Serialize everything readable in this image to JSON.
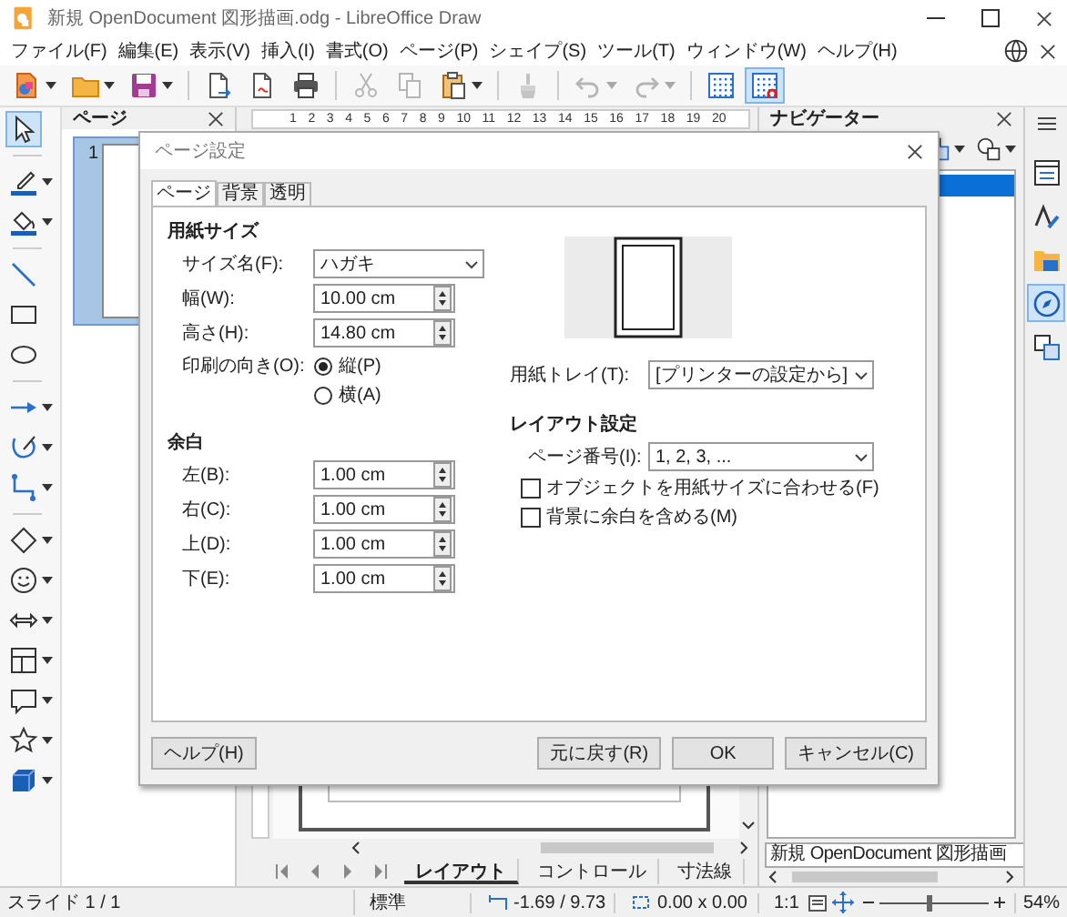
{
  "window": {
    "title": "新規 OpenDocument 図形描画.odg - LibreOffice Draw"
  },
  "menu": [
    "ファイル(F)",
    "編集(E)",
    "表示(V)",
    "挿入(I)",
    "書式(O)",
    "ページ(P)",
    "シェイプ(S)",
    "ツール(T)",
    "ウィンドウ(W)",
    "ヘルプ(H)"
  ],
  "toolbar": [
    [
      {
        "kind": "new",
        "dropdown": true,
        "disabled": false,
        "selected": false
      },
      {
        "kind": "open",
        "dropdown": true,
        "disabled": false,
        "selected": false
      },
      {
        "kind": "save",
        "dropdown": true,
        "disabled": false,
        "selected": false
      }
    ],
    [
      {
        "kind": "export",
        "dropdown": false,
        "disabled": false,
        "selected": false
      },
      {
        "kind": "pdf",
        "dropdown": false,
        "disabled": false,
        "selected": false
      },
      {
        "kind": "print",
        "dropdown": false,
        "disabled": false,
        "selected": false
      }
    ],
    [
      {
        "kind": "cut",
        "dropdown": false,
        "disabled": true,
        "selected": false
      },
      {
        "kind": "copy",
        "dropdown": false,
        "disabled": true,
        "selected": false
      },
      {
        "kind": "paste",
        "dropdown": true,
        "disabled": false,
        "selected": false
      }
    ],
    [
      {
        "kind": "clone",
        "dropdown": false,
        "disabled": true,
        "selected": false
      }
    ],
    [
      {
        "kind": "undo",
        "dropdown": true,
        "disabled": true,
        "selected": false
      },
      {
        "kind": "redo",
        "dropdown": true,
        "disabled": true,
        "selected": false
      }
    ],
    [
      {
        "kind": "grid",
        "dropdown": false,
        "disabled": false,
        "selected": false
      },
      {
        "kind": "helplines",
        "dropdown": false,
        "disabled": false,
        "selected": true
      }
    ]
  ],
  "tools": [
    [
      {
        "kind": "select",
        "dropdown": false,
        "selected": true
      }
    ],
    [
      {
        "kind": "linecolor",
        "dropdown": true,
        "selected": false
      },
      {
        "kind": "fillcolor",
        "dropdown": true,
        "selected": false
      }
    ],
    [
      {
        "kind": "line",
        "dropdown": false,
        "selected": false
      },
      {
        "kind": "rect",
        "dropdown": false,
        "selected": false
      },
      {
        "kind": "ellipse",
        "dropdown": false,
        "selected": false
      }
    ],
    [
      {
        "kind": "arrowline",
        "dropdown": true,
        "selected": false
      },
      {
        "kind": "curve",
        "dropdown": true,
        "selected": false
      },
      {
        "kind": "connector",
        "dropdown": true,
        "selected": false
      }
    ],
    [
      {
        "kind": "diamond",
        "dropdown": true,
        "selected": false
      },
      {
        "kind": "smiley",
        "dropdown": true,
        "selected": false
      },
      {
        "kind": "doublearrow",
        "dropdown": true,
        "selected": false
      },
      {
        "kind": "flowchart",
        "dropdown": true,
        "selected": false
      },
      {
        "kind": "callout",
        "dropdown": true,
        "selected": false
      },
      {
        "kind": "star",
        "dropdown": true,
        "selected": false
      },
      {
        "kind": "cube",
        "dropdown": true,
        "selected": false
      }
    ]
  ],
  "pages_panel": {
    "title": "ページ",
    "pages": [
      {
        "number": "1",
        "selected": true
      }
    ]
  },
  "ruler": [
    "1",
    "2",
    "3",
    "4",
    "5",
    "6",
    "7",
    "8",
    "9",
    "10",
    "11",
    "12",
    "13",
    "14",
    "15",
    "16",
    "17",
    "18",
    "19",
    "20"
  ],
  "layer_tabs": [
    {
      "label": "レイアウト",
      "selected": true
    },
    {
      "label": "コントロール",
      "selected": false
    },
    {
      "label": "寸法線",
      "selected": false
    }
  ],
  "navigator": {
    "title": "ナビゲーター",
    "tools": [
      {
        "kind": "shapes",
        "dropdown": true
      },
      {
        "kind": "drag",
        "dropdown": true
      }
    ],
    "items": [
      {
        "selected": true
      }
    ],
    "document": "新規 OpenDocument 図形描画"
  },
  "sidebar_tabs": [
    {
      "kind": "properties",
      "selected": false
    },
    {
      "kind": "styles",
      "selected": false
    },
    {
      "kind": "gallery",
      "selected": false
    },
    {
      "kind": "navigator",
      "selected": true
    },
    {
      "kind": "shapes",
      "selected": false
    }
  ],
  "status_bar": {
    "slide": "スライド 1 / 1",
    "layout": "標準",
    "position": "-1.69 / 9.73",
    "size": "0.00 x 0.00",
    "scale": "1:1",
    "zoom_slider": {
      "level": 0.45
    },
    "zoom": "54%"
  },
  "dialog": {
    "title": "ページ設定",
    "tabs": [
      {
        "label": "ページ",
        "selected": true
      },
      {
        "label": "背景",
        "selected": false
      },
      {
        "label": "透明",
        "selected": false
      }
    ],
    "paper_format": {
      "heading": "用紙サイズ",
      "fields": [
        {
          "label": "サイズ名(F):",
          "kind": "select",
          "value": "ハガキ"
        },
        {
          "label": "幅(W):",
          "kind": "spin",
          "value": "10.00 cm"
        },
        {
          "label": "高さ(H):",
          "kind": "spin",
          "value": "14.80 cm"
        }
      ],
      "orientation": {
        "label": "印刷の向き(O):",
        "options": [
          {
            "label": "縦(P)",
            "selected": true
          },
          {
            "label": "横(A)",
            "selected": false
          }
        ]
      }
    },
    "margins": {
      "heading": "余白",
      "fields": [
        {
          "label": "左(B):",
          "kind": "spin",
          "value": "1.00 cm"
        },
        {
          "label": "右(C):",
          "kind": "spin",
          "value": "1.00 cm"
        },
        {
          "label": "上(D):",
          "kind": "spin",
          "value": "1.00 cm"
        },
        {
          "label": "下(E):",
          "kind": "spin",
          "value": "1.00 cm"
        }
      ]
    },
    "paper_tray": {
      "label": "用紙トレイ(T):",
      "kind": "select",
      "value": "[プリンターの設定から]"
    },
    "layout_settings": {
      "heading": "レイアウト設定",
      "page_numbers": {
        "label": "ページ番号(I):",
        "kind": "select",
        "value": "1, 2, 3, ..."
      },
      "checkboxes": [
        {
          "label": "オブジェクトを用紙サイズに合わせる(F)",
          "checked": false
        },
        {
          "label": "背景に余白を含める(M)",
          "checked": false
        }
      ]
    },
    "buttons": [
      {
        "label": "ヘルプ(H)",
        "kind": "help"
      },
      {
        "label": "元に戻す(R)",
        "kind": "action"
      },
      {
        "label": "OK",
        "kind": "action"
      },
      {
        "label": "キャンセル(C)",
        "kind": "action"
      }
    ]
  }
}
